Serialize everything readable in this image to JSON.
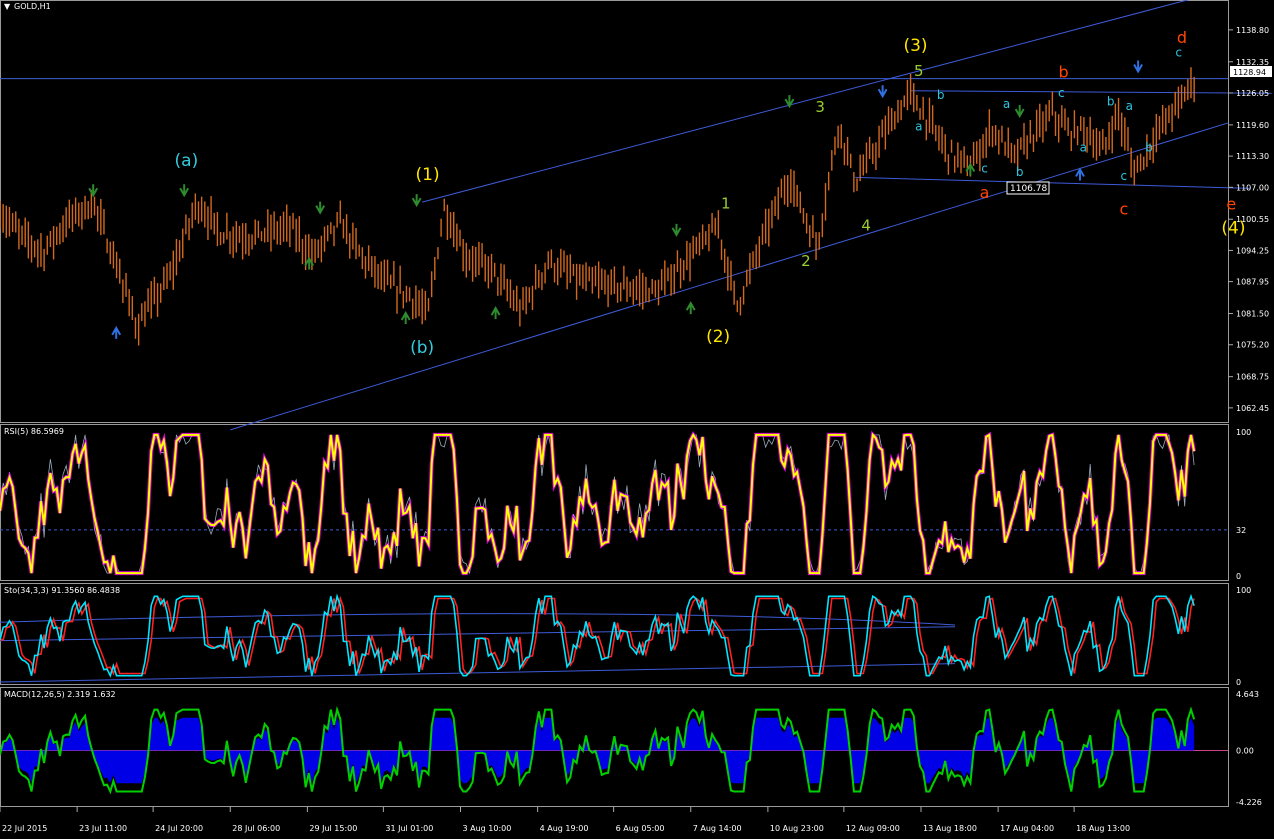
{
  "window": {
    "title": "GOLD,H1",
    "price_tag": "1128.94",
    "level_tag": "1106.78"
  },
  "colors": {
    "background": "#000000",
    "candle": "#d2691e",
    "channel": "#3e5bd8",
    "rsi_line": "#ffff00",
    "rsi_dots": "#ff00ff",
    "stoch_main": "#00e5ff",
    "stoch_signal": "#ff2020",
    "macd_hist": "#0000ff",
    "macd_line": "#00d000",
    "wave_yellow": "#ffe600",
    "wave_cyan": "#33ccdd",
    "wave_green": "#9acd32",
    "wave_red": "#ff4500",
    "wave_small": "#2ec4e0"
  },
  "chart_data": [
    {
      "type": "candlestick",
      "symbol": "GOLD",
      "timeframe": "H1",
      "ylim": [
        1060.0,
        1142.0
      ],
      "y_ticks": [
        "1138.80",
        "1132.35",
        "1126.05",
        "1119.60",
        "1113.30",
        "1107.00",
        "1100.55",
        "1094.25",
        "1087.95",
        "1081.50",
        "1075.20",
        "1068.75",
        "1062.45"
      ],
      "x_ticks": [
        "22 Jul 2015",
        "23 Jul 11:00",
        "24 Jul 20:00",
        "28 Jul 06:00",
        "29 Jul 15:00",
        "31 Jul 01:00",
        "3 Aug 10:00",
        "4 Aug 19:00",
        "6 Aug 05:00",
        "7 Aug 14:00",
        "10 Aug 23:00",
        "12 Aug 09:00",
        "13 Aug 18:00",
        "17 Aug 04:00",
        "18 Aug 13:00"
      ],
      "current_price": 1128.94,
      "marked_level": 1106.78,
      "price_path": [
        {
          "x": 0.0,
          "p": 1102
        },
        {
          "x": 0.02,
          "p": 1097
        },
        {
          "x": 0.04,
          "p": 1094
        },
        {
          "x": 0.06,
          "p": 1100
        },
        {
          "x": 0.085,
          "p": 1104
        },
        {
          "x": 0.105,
          "p": 1092
        },
        {
          "x": 0.125,
          "p": 1079
        },
        {
          "x": 0.155,
          "p": 1089
        },
        {
          "x": 0.18,
          "p": 1104
        },
        {
          "x": 0.2,
          "p": 1098
        },
        {
          "x": 0.225,
          "p": 1097
        },
        {
          "x": 0.265,
          "p": 1099
        },
        {
          "x": 0.285,
          "p": 1093
        },
        {
          "x": 0.31,
          "p": 1100
        },
        {
          "x": 0.33,
          "p": 1093
        },
        {
          "x": 0.35,
          "p": 1088
        },
        {
          "x": 0.375,
          "p": 1085
        },
        {
          "x": 0.39,
          "p": 1081
        },
        {
          "x": 0.405,
          "p": 1103
        },
        {
          "x": 0.425,
          "p": 1093
        },
        {
          "x": 0.45,
          "p": 1090
        },
        {
          "x": 0.475,
          "p": 1082
        },
        {
          "x": 0.5,
          "p": 1092
        },
        {
          "x": 0.53,
          "p": 1088
        },
        {
          "x": 0.56,
          "p": 1087
        },
        {
          "x": 0.6,
          "p": 1086
        },
        {
          "x": 0.625,
          "p": 1092
        },
        {
          "x": 0.655,
          "p": 1099
        },
        {
          "x": 0.672,
          "p": 1083
        },
        {
          "x": 0.7,
          "p": 1099
        },
        {
          "x": 0.72,
          "p": 1109
        },
        {
          "x": 0.745,
          "p": 1095
        },
        {
          "x": 0.765,
          "p": 1120
        },
        {
          "x": 0.78,
          "p": 1108
        },
        {
          "x": 0.81,
          "p": 1119
        },
        {
          "x": 0.83,
          "p": 1126
        },
        {
          "x": 0.845,
          "p": 1121
        },
        {
          "x": 0.865,
          "p": 1114
        },
        {
          "x": 0.885,
          "p": 1111
        },
        {
          "x": 0.905,
          "p": 1119
        },
        {
          "x": 0.925,
          "p": 1113
        },
        {
          "x": 0.94,
          "p": 1117
        },
        {
          "x": 0.96,
          "p": 1122
        },
        {
          "x": 0.975,
          "p": 1118
        },
        {
          "x": 0.99,
          "p": 1119
        },
        {
          "x": 1.005,
          "p": 1114
        },
        {
          "x": 1.02,
          "p": 1122
        },
        {
          "x": 1.035,
          "p": 1110
        },
        {
          "x": 1.055,
          "p": 1118
        },
        {
          "x": 1.075,
          "p": 1124
        },
        {
          "x": 1.09,
          "p": 1129
        }
      ],
      "wave_labels": [
        {
          "text": "(a)",
          "color": "#33ccdd",
          "ts": 0.17,
          "p": 1111.3,
          "size": 17
        },
        {
          "text": "(b)",
          "color": "#33ccdd",
          "ts": 0.385,
          "p": 1073.5,
          "size": 17
        },
        {
          "text": "(1)",
          "color": "#ffe600",
          "ts": 0.39,
          "p": 1108.5,
          "size": 17
        },
        {
          "text": "(2)",
          "color": "#ffe600",
          "ts": 0.655,
          "p": 1075.8,
          "size": 17
        },
        {
          "text": "(3)",
          "color": "#ffe600",
          "ts": 0.835,
          "p": 1134.5,
          "size": 17
        },
        {
          "text": "(4)",
          "color": "#ffe600",
          "ts": 1.125,
          "p": 1097.7,
          "size": 17
        },
        {
          "text": "1",
          "color": "#9acd32",
          "ts": 0.662,
          "p": 1102.7,
          "size": 15
        },
        {
          "text": "2",
          "color": "#9acd32",
          "ts": 0.735,
          "p": 1091.1,
          "size": 15
        },
        {
          "text": "3",
          "color": "#9acd32",
          "ts": 0.748,
          "p": 1122.2,
          "size": 15
        },
        {
          "text": "4",
          "color": "#9acd32",
          "ts": 0.79,
          "p": 1098.3,
          "size": 15
        },
        {
          "text": "5",
          "color": "#9acd32",
          "ts": 0.838,
          "p": 1129.5,
          "size": 15
        },
        {
          "text": "a",
          "color": "#ff4500",
          "ts": 0.898,
          "p": 1104.8,
          "size": 16
        },
        {
          "text": "b",
          "color": "#ff4500",
          "ts": 0.97,
          "p": 1129.2,
          "size": 16
        },
        {
          "text": "c",
          "color": "#ff4500",
          "ts": 1.025,
          "p": 1101.5,
          "size": 16
        },
        {
          "text": "d",
          "color": "#ff4500",
          "ts": 1.078,
          "p": 1136.1,
          "size": 16
        },
        {
          "text": "e",
          "color": "#ff4500",
          "ts": 1.123,
          "p": 1102.5,
          "size": 16
        },
        {
          "text": "b",
          "color": "#2ec4e0",
          "ts": 0.858,
          "p": 1124.8,
          "size": 12
        },
        {
          "text": "a",
          "color": "#2ec4e0",
          "ts": 0.838,
          "p": 1118.5,
          "size": 12
        },
        {
          "text": "c",
          "color": "#2ec4e0",
          "ts": 0.898,
          "p": 1110.0,
          "size": 12
        },
        {
          "text": "b",
          "color": "#2ec4e0",
          "ts": 0.93,
          "p": 1109.3,
          "size": 12
        },
        {
          "text": "a",
          "color": "#2ec4e0",
          "ts": 0.918,
          "p": 1123.0,
          "size": 12
        },
        {
          "text": "c",
          "color": "#2ec4e0",
          "ts": 0.968,
          "p": 1125.2,
          "size": 12
        },
        {
          "text": "a",
          "color": "#2ec4e0",
          "ts": 0.988,
          "p": 1114.2,
          "size": 12
        },
        {
          "text": "b",
          "color": "#2ec4e0",
          "ts": 1.013,
          "p": 1123.5,
          "size": 12
        },
        {
          "text": "a",
          "color": "#2ec4e0",
          "ts": 1.03,
          "p": 1122.6,
          "size": 12
        },
        {
          "text": "b",
          "color": "#2ec4e0",
          "ts": 1.048,
          "p": 1114.2,
          "size": 12
        },
        {
          "text": "c",
          "color": "#2ec4e0",
          "ts": 1.025,
          "p": 1108.5,
          "size": 12
        },
        {
          "text": "c",
          "color": "#2ec4e0",
          "ts": 1.075,
          "p": 1133.4,
          "size": 12
        }
      ]
    },
    {
      "type": "line",
      "indicator": "RSI",
      "header": "RSI(5) 86.5969",
      "ylim": [
        0,
        100
      ],
      "y_ticks": [
        "100",
        "32",
        "0"
      ],
      "level": 32,
      "last_value": 86.5969
    },
    {
      "type": "line",
      "indicator": "Stochastic",
      "header": "Sto(34,3,3) 91.3560 86.4838",
      "ylim": [
        0,
        100
      ],
      "y_ticks": [
        "100",
        "0"
      ],
      "main_last": 91.356,
      "signal_last": 86.4838
    },
    {
      "type": "area",
      "indicator": "MACD",
      "header": "MACD(12,26,5) 2.319 1.632",
      "ylim": [
        -4.226,
        4.643
      ],
      "y_ticks": [
        "4.643",
        "0.00",
        "-4.226"
      ],
      "macd_last": 2.319,
      "signal_last": 1.632
    }
  ]
}
